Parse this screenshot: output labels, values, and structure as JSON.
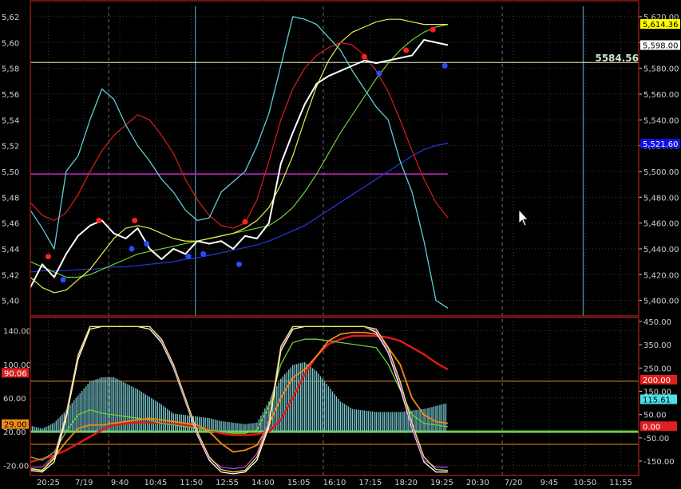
{
  "colors": {
    "bg": "#000000",
    "frame": "#8c1a1a",
    "grid": "#3a3a3a",
    "axis_text": "#d0d0d0",
    "white": "#ffffff",
    "cyan": "#5ecfd6",
    "red": "#d8201c",
    "yellow": "#ecec50",
    "green": "#6cd03a",
    "blue": "#2a36e0",
    "magenta": "#c02cc8",
    "orange": "#f08a18",
    "crosshair": "#e8e8c0",
    "vline": "#6ab0d0",
    "hist": "#78c8d0",
    "dot_red": "#ff2020",
    "dot_blue": "#2a4cff",
    "osc_purple": "#b040e0",
    "osc_red": "#e01818"
  },
  "chart_data": [
    {
      "type": "line",
      "x": [
        0,
        4,
        8,
        12,
        16,
        20,
        24,
        28,
        32,
        36,
        40,
        44,
        48,
        52,
        56,
        60,
        64,
        68,
        72,
        76,
        80,
        84,
        88,
        92,
        96,
        100,
        104,
        108,
        112,
        116,
        120,
        124,
        128,
        132,
        136,
        140
      ],
      "x_tick_labels": [
        "20:25",
        "7/19",
        "9:40",
        "10:45",
        "11:50",
        "12:55",
        "14:00",
        "15:05",
        "16:10",
        "17:15",
        "18:20",
        "19:25",
        "20:30",
        "7/20",
        "9:45",
        "10:50",
        "11:55"
      ],
      "x_tick_positions": [
        6,
        18,
        30,
        42,
        54,
        66,
        78,
        90,
        102,
        114,
        126,
        138,
        150,
        162,
        174,
        186,
        198
      ],
      "xlim": [
        0,
        204
      ],
      "y_tick_labels": [
        "5,400.00",
        "5,420.00",
        "5,440.00",
        "5,460.00",
        "5,480.00",
        "5,500.00",
        "5,520.00",
        "5,540.00",
        "5,560.00",
        "5,580.00",
        "5,600.00",
        "5,620.00"
      ],
      "y_tick_values_left": [
        "5,40",
        "5,42",
        "5,44",
        "5,46",
        "5,48",
        "5,50",
        "5,52",
        "5,54",
        "5,56",
        "5,58",
        "5,60",
        "5,62"
      ],
      "ylim": [
        5388,
        5628
      ],
      "crosshair_value": "5584.56",
      "price_tags": [
        {
          "value": 5614.36,
          "label": "5,614.36",
          "fill": "#ffff00",
          "text": "#000000"
        },
        {
          "value": 5598.0,
          "label": "5,598.00",
          "fill": "#ffffff",
          "text": "#000000"
        },
        {
          "value": 5521.6,
          "label": "5,521.60",
          "fill": "#1010e0",
          "text": "#ffffff"
        }
      ],
      "hline_magenta": 5498,
      "series": [
        {
          "color_key": "white",
          "values": [
            5410,
            5428,
            5418,
            5436,
            5450,
            5458,
            5462,
            5452,
            5448,
            5456,
            5440,
            5432,
            5440,
            5436,
            5446,
            5444,
            5446,
            5440,
            5450,
            5448,
            5460,
            5506,
            5530,
            5552,
            5568,
            5574,
            5578,
            5582,
            5586,
            5584,
            5586,
            5588,
            5590,
            5602,
            5600,
            5598
          ]
        },
        {
          "color_key": "cyan",
          "values": [
            5470,
            5456,
            5440,
            5500,
            5512,
            5540,
            5564,
            5556,
            5536,
            5520,
            5508,
            5494,
            5484,
            5470,
            5462,
            5464,
            5484,
            5492,
            5500,
            5520,
            5545,
            5582,
            5620,
            5618,
            5614,
            5604,
            5594,
            5578,
            5564,
            5550,
            5540,
            5508,
            5484,
            5446,
            5400,
            5394
          ]
        },
        {
          "color_key": "red",
          "values": [
            5476,
            5466,
            5462,
            5468,
            5482,
            5500,
            5516,
            5528,
            5536,
            5544,
            5540,
            5528,
            5514,
            5494,
            5478,
            5466,
            5458,
            5456,
            5460,
            5478,
            5508,
            5540,
            5564,
            5580,
            5590,
            5596,
            5600,
            5598,
            5590,
            5578,
            5562,
            5540,
            5516,
            5494,
            5476,
            5464
          ]
        },
        {
          "color_key": "yellow",
          "values": [
            5418,
            5410,
            5406,
            5408,
            5416,
            5424,
            5436,
            5448,
            5456,
            5458,
            5456,
            5452,
            5448,
            5446,
            5446,
            5448,
            5450,
            5452,
            5456,
            5462,
            5472,
            5490,
            5512,
            5540,
            5566,
            5586,
            5600,
            5608,
            5612,
            5616,
            5618,
            5618,
            5616,
            5614,
            5614,
            5614
          ]
        },
        {
          "color_key": "green",
          "values": [
            5430,
            5426,
            5422,
            5418,
            5418,
            5420,
            5424,
            5428,
            5432,
            5436,
            5438,
            5440,
            5442,
            5444,
            5446,
            5448,
            5450,
            5452,
            5454,
            5456,
            5458,
            5464,
            5472,
            5484,
            5498,
            5514,
            5530,
            5544,
            5558,
            5572,
            5584,
            5594,
            5602,
            5608,
            5612,
            5614
          ]
        },
        {
          "color_key": "blue",
          "values": [
            5422,
            5423,
            5423,
            5423,
            5424,
            5424,
            5425,
            5426,
            5426,
            5427,
            5428,
            5429,
            5430,
            5432,
            5433,
            5435,
            5437,
            5439,
            5441,
            5443,
            5446,
            5450,
            5454,
            5458,
            5464,
            5470,
            5476,
            5482,
            5488,
            5494,
            5500,
            5506,
            5512,
            5517,
            5520,
            5522
          ]
        }
      ],
      "markers": [
        {
          "x": 6,
          "y": 5434,
          "color_key": "dot_red"
        },
        {
          "x": 11,
          "y": 5416,
          "color_key": "dot_blue"
        },
        {
          "x": 23,
          "y": 5462,
          "color_key": "dot_red"
        },
        {
          "x": 35,
          "y": 5462,
          "color_key": "dot_red"
        },
        {
          "x": 34,
          "y": 5440,
          "color_key": "dot_blue"
        },
        {
          "x": 39,
          "y": 5444,
          "color_key": "dot_blue"
        },
        {
          "x": 53,
          "y": 5434,
          "color_key": "dot_blue"
        },
        {
          "x": 58,
          "y": 5436,
          "color_key": "dot_blue"
        },
        {
          "x": 70,
          "y": 5428,
          "color_key": "dot_blue"
        },
        {
          "x": 72,
          "y": 5461,
          "color_key": "dot_red"
        },
        {
          "x": 112,
          "y": 5589,
          "color_key": "dot_red"
        },
        {
          "x": 117,
          "y": 5576,
          "color_key": "dot_blue"
        },
        {
          "x": 126,
          "y": 5594,
          "color_key": "dot_red"
        },
        {
          "x": 135,
          "y": 5610,
          "color_key": "dot_red"
        },
        {
          "x": 139,
          "y": 5582,
          "color_key": "dot_blue"
        }
      ]
    },
    {
      "type": "line",
      "x": [
        0,
        4,
        8,
        12,
        16,
        20,
        24,
        28,
        32,
        36,
        40,
        44,
        48,
        52,
        56,
        60,
        64,
        68,
        72,
        76,
        80,
        84,
        88,
        92,
        96,
        100,
        104,
        108,
        112,
        116,
        120,
        124,
        128,
        132,
        136,
        140
      ],
      "ylim_left": [
        -32,
        152
      ],
      "y_tick_labels_left": [
        "-20.00",
        "20.00",
        "60.00",
        "100.00",
        "140.00"
      ],
      "y_tick_values_left": [
        -20,
        20,
        60,
        100,
        140
      ],
      "y_tick_labels_right": [
        "-150.00",
        "-50.00",
        "50.00",
        "150.00",
        "250.00",
        "350.00",
        "450.00"
      ],
      "y_tick_values_right": [
        -150,
        -50,
        50,
        150,
        250,
        350,
        450
      ],
      "left_tags": [
        {
          "value": 90.06,
          "label": "90.06",
          "fill": "#d82020",
          "text": "#ffffff"
        },
        {
          "value": 29.0,
          "label": "29.00",
          "fill": "#f08a18",
          "text": "#000000"
        }
      ],
      "right_tags": [
        {
          "value": 200,
          "label": "200.00",
          "fill": "#e02020",
          "text": "#ffffff"
        },
        {
          "value": 115.61,
          "label": "115.61",
          "fill": "#4ce0e8",
          "text": "#000000"
        },
        {
          "value": 0,
          "label": "0.00",
          "fill": "#e02020",
          "text": "#ffffff"
        }
      ],
      "hlines": [
        {
          "value": 20,
          "color_key": "green",
          "width": 3
        },
        {
          "value": 80,
          "color_key": "orange",
          "width": 1
        },
        {
          "value": 5,
          "color_key": "orange",
          "width": 1
        }
      ],
      "series": [
        {
          "color_key": "yellow",
          "values": [
            -24,
            -26,
            -12,
            40,
            110,
            145,
            145,
            145,
            145,
            145,
            145,
            130,
            100,
            60,
            20,
            -10,
            -25,
            -28,
            -26,
            -10,
            30,
            120,
            145,
            145,
            145,
            145,
            145,
            145,
            145,
            142,
            120,
            80,
            30,
            -10,
            -25,
            -26
          ]
        },
        {
          "color_key": "osc_purple",
          "values": [
            -22,
            -22,
            -8,
            42,
            112,
            145,
            145,
            145,
            145,
            145,
            145,
            128,
            98,
            58,
            18,
            -12,
            -22,
            -24,
            -22,
            -6,
            34,
            122,
            145,
            145,
            145,
            145,
            145,
            145,
            145,
            140,
            116,
            76,
            26,
            -14,
            -22,
            -22
          ]
        },
        {
          "color_key": "white",
          "values": [
            -26,
            -28,
            -16,
            36,
            106,
            142,
            145,
            145,
            145,
            145,
            142,
            126,
            96,
            56,
            16,
            -14,
            -28,
            -30,
            -28,
            -14,
            26,
            116,
            142,
            145,
            145,
            145,
            145,
            145,
            145,
            138,
            114,
            72,
            24,
            -16,
            -28,
            -28
          ]
        },
        {
          "color_key": "green",
          "values": [
            -10,
            -14,
            -4,
            20,
            40,
            46,
            42,
            40,
            38,
            36,
            34,
            30,
            28,
            26,
            24,
            22,
            20,
            18,
            18,
            22,
            50,
            100,
            126,
            130,
            130,
            128,
            126,
            124,
            122,
            120,
            100,
            70,
            40,
            30,
            28,
            26
          ]
        },
        {
          "color_key": "osc_red",
          "values": [
            -16,
            -12,
            -8,
            -2,
            6,
            14,
            22,
            28,
            30,
            31,
            31,
            30,
            29,
            28,
            25,
            22,
            18,
            16,
            16,
            17,
            20,
            34,
            60,
            88,
            110,
            124,
            130,
            134,
            134,
            134,
            132,
            128,
            120,
            112,
            102,
            94
          ]
        },
        {
          "color_key": "orange",
          "values": [
            -24,
            -26,
            -10,
            8,
            24,
            28,
            28,
            30,
            32,
            34,
            36,
            34,
            32,
            30,
            28,
            20,
            6,
            -4,
            -2,
            4,
            28,
            60,
            84,
            94,
            110,
            128,
            136,
            138,
            138,
            136,
            120,
            100,
            60,
            40,
            32,
            30
          ]
        }
      ],
      "histogram": [
        8,
        4,
        12,
        28,
        48,
        66,
        72,
        72,
        64,
        56,
        46,
        36,
        24,
        22,
        20,
        18,
        14,
        12,
        10,
        12,
        40,
        70,
        88,
        92,
        80,
        60,
        40,
        30,
        28,
        26,
        26,
        26,
        28,
        30,
        34,
        38
      ]
    }
  ]
}
